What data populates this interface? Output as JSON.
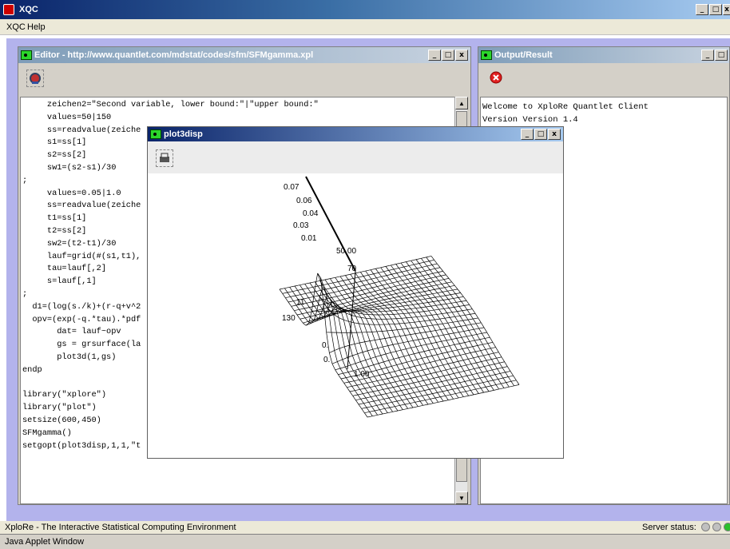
{
  "app": {
    "title": "XQC",
    "menu": [
      "XQC",
      "Help"
    ]
  },
  "editor": {
    "title": "Editor - http://www.quantlet.com/mdstat/codes/sfm/SFMgamma.xpl",
    "lines": [
      "     zeichen2=\"Second variable, lower bound:\"|\"upper bound:\"",
      "     values=50|150",
      "     ss=readvalue(zeiche",
      "     s1=ss[1]",
      "     s2=ss[2]",
      "     sw1=(s2-s1)/30",
      ";",
      "     values=0.05|1.0",
      "     ss=readvalue(zeiche",
      "     t1=ss[1]",
      "     t2=ss[2]",
      "     sw2=(t2-t1)/30",
      "     lauf=grid(#(s1,t1),",
      "     tau=lauf[,2]",
      "     s=lauf[,1]",
      ";",
      "  d1=(log(s./k)+(r-q+v^2",
      "  opv=(exp(-q.*tau).*pdf",
      "       dat= lauf~opv",
      "       gs = grsurface(la",
      "       plot3d(1,gs)",
      "endp",
      "",
      "library(\"xplore\")",
      "library(\"plot\")",
      "setsize(600,450)",
      "SFMgamma()",
      "setgopt(plot3disp,1,1,\"t"
    ]
  },
  "output": {
    "title": "Output/Result",
    "lines": [
      "Welcome to XploRe Quantlet Client",
      "Version Version 1.4"
    ]
  },
  "plot": {
    "title": "plot3disp",
    "axis_labels": [
      "0.07",
      "0.06",
      "0.04",
      "0.03",
      "0.01",
      "50.00",
      "70",
      "11",
      "130",
      "0.",
      "0.",
      "1.00"
    ]
  },
  "status": {
    "left": "XploRe - The Interactive Statistical Computing Environment",
    "server": "Server status:",
    "leds": [
      "#c0c0c0",
      "#c0c0c0",
      "#2bbf2b"
    ]
  },
  "applet": "Java Applet Window"
}
